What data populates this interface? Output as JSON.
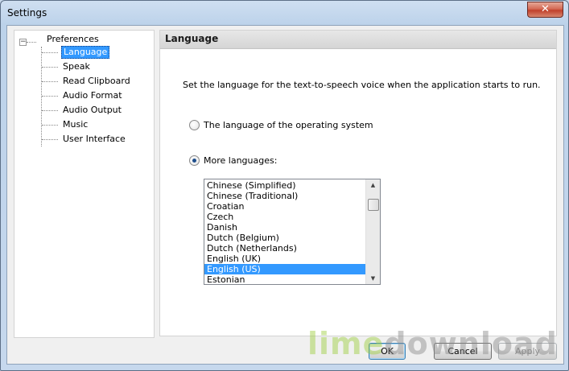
{
  "window": {
    "title": "Settings",
    "close_glyph": "✕"
  },
  "tree": {
    "toggle_glyph": "−",
    "root": "Preferences",
    "items": [
      {
        "label": "Language",
        "selected": true
      },
      {
        "label": "Speak"
      },
      {
        "label": "Read Clipboard"
      },
      {
        "label": "Audio Format"
      },
      {
        "label": "Audio Output"
      },
      {
        "label": "Music"
      },
      {
        "label": "User Interface"
      }
    ]
  },
  "panel": {
    "title": "Language",
    "description": "Set the language for the text-to-speech voice when the application starts to run.",
    "option_os": {
      "label": "The language of the operating system",
      "checked": false
    },
    "option_more": {
      "label": "More languages:",
      "checked": true
    }
  },
  "languages": {
    "items": [
      "Chinese (Simplified)",
      "Chinese (Traditional)",
      "Croatian",
      "Czech",
      "Danish",
      "Dutch (Belgium)",
      "Dutch (Netherlands)",
      "English (UK)",
      "English (US)",
      "Estonian"
    ],
    "selected": "English (US)"
  },
  "buttons": {
    "ok": "OK",
    "cancel": "Cancel",
    "apply": "Apply"
  },
  "watermark": {
    "part1": "lime",
    "part2": "download",
    "colors": {
      "lime": "#9ccd3b",
      "gray": "#8a8a8a"
    }
  },
  "colors": {
    "selection": "#3399ff",
    "close_button": "#c0402b"
  }
}
